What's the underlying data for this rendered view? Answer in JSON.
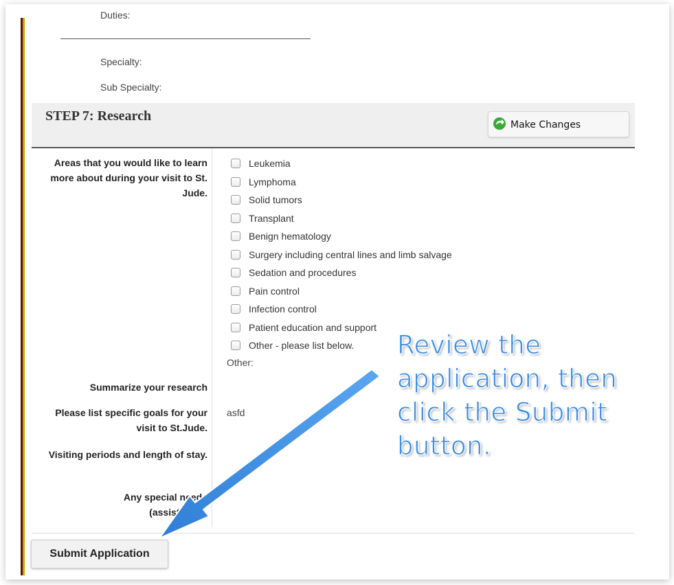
{
  "previous_section": {
    "duties_label": "Duties:",
    "specialty_label": "Specialty:",
    "sub_specialty_label": "Sub Specialty:"
  },
  "step": {
    "title": "STEP 7: Research",
    "make_changes_label": "Make Changes",
    "make_changes_icon": "green-curved-arrow-icon"
  },
  "areas": {
    "label": "Areas that you would like to learn more about during your visit to St. Jude.",
    "options": [
      {
        "label": "Leukemia",
        "checked": false
      },
      {
        "label": "Lymphoma",
        "checked": false
      },
      {
        "label": "Solid tumors",
        "checked": false
      },
      {
        "label": "Transplant",
        "checked": false
      },
      {
        "label": "Benign hematology",
        "checked": false
      },
      {
        "label": "Surgery including central lines and limb salvage",
        "checked": false
      },
      {
        "label": "Sedation and procedures",
        "checked": false
      },
      {
        "label": "Pain control",
        "checked": false
      },
      {
        "label": "Infection control",
        "checked": false
      },
      {
        "label": "Patient education and support",
        "checked": false
      },
      {
        "label": "Other - please list below.",
        "checked": false
      }
    ],
    "other_label": "Other:"
  },
  "fields": {
    "summarize_label": "Summarize your research",
    "goals_label": "Please list specific goals for your visit to St.Jude.",
    "goals_value": "asfd",
    "visiting_label": "Visiting periods and length of stay.",
    "special_needs_label": "Any special needs (assistance)."
  },
  "submit": {
    "label": "Submit Application"
  },
  "annotation": {
    "text": "Review the application, then click the Submit button.",
    "color": "#3f8fe3"
  }
}
